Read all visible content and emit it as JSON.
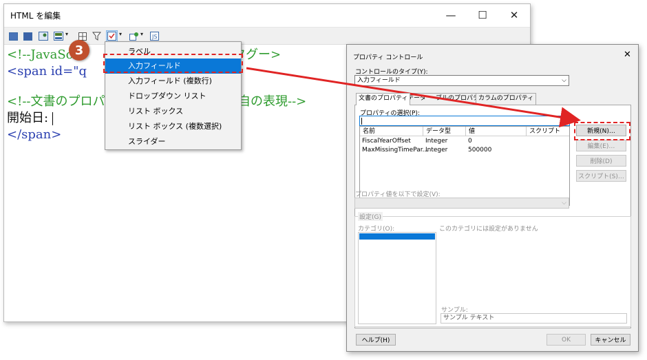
{
  "editor": {
    "title": "HTML を編集",
    "window_buttons": {
      "minimize": "—",
      "maximize": "☐",
      "close": "✕"
    },
    "code_lines": [
      "<!--JavaScr",
      "<span id=\"q",
      "<!--文書のプロパテ",
      "開始日:",
      "</span>"
    ],
    "code_right_fragments": {
      "line1": "タグー>",
      "line3": "自の表現-->"
    },
    "step_badge": "3"
  },
  "menu": {
    "items": [
      "ラベル",
      "入力フィールド",
      "入力フィールド (複数行)",
      "ドロップダウン リスト",
      "リスト ボックス",
      "リスト ボックス (複数選択)",
      "スライダー"
    ],
    "selected_index": 1
  },
  "dialog": {
    "title": "プロパティ コントロール",
    "close": "✕",
    "control_type_label": "コントロールのタイプ(Y):",
    "control_type_value": "入力フィールド",
    "tabs": [
      "文書のプロパティ",
      "データ",
      "ブルのプロパティ",
      "カラムのプロパティ"
    ],
    "property_select_label": "プロパティの選択(P):",
    "property_input_value": "",
    "table": {
      "headers": [
        "名前",
        "データ型",
        "値",
        "スクリプト"
      ],
      "rows": [
        [
          "FiscalYearOffset",
          "Integer",
          "0",
          ""
        ],
        [
          "MaxMissingTimePar...",
          "Integer",
          "500000",
          ""
        ]
      ]
    },
    "side_buttons": {
      "new": "新規(N)…",
      "edit": "編集(E)…",
      "delete": "削除(D)",
      "script": "スクリプト(S)…"
    },
    "set_value_label": "プロパティ値を以下で設定(V):",
    "settings_group": "設定(G)",
    "category_label": "カテゴリ(O):",
    "no_settings_text": "このカテゴリには設定がありません",
    "sample_label": "サンプル:",
    "sample_text": "サンプル テキスト",
    "help_button": "ヘルプ(H)",
    "ok_button": "OK",
    "cancel_button": "キャンセル"
  },
  "colors": {
    "accent": "#0a78d7",
    "highlight": "#e02424",
    "badge": "#c0502e"
  }
}
